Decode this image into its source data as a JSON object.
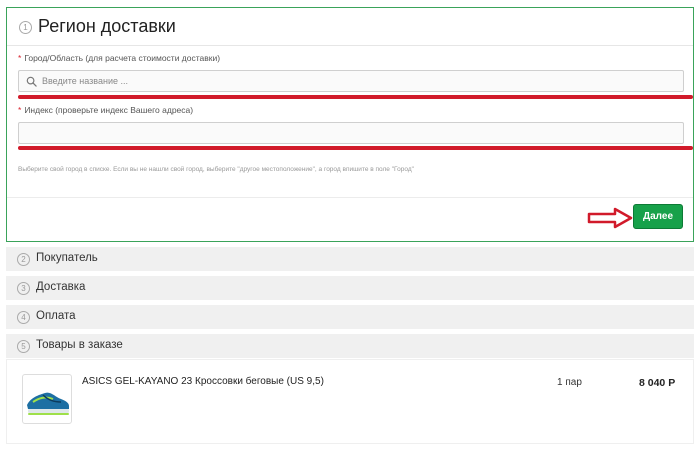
{
  "region": {
    "step": "1",
    "title": "Регион доставки",
    "city_label": "Город/Область (для расчета стоимости доставки)",
    "city_placeholder": "Введите название ...",
    "index_label": "Индекс (проверьте индекс Вашего адреса)",
    "index_value": "",
    "required_mark": "*",
    "hint": "Выберите свой город в списке. Если вы не нашли свой город, выберите \"другое местоположение\", а город впишите в поле \"Город\"",
    "next_button": "Далее"
  },
  "sections": [
    {
      "step": "2",
      "label": "Покупатель"
    },
    {
      "step": "3",
      "label": "Доставка"
    },
    {
      "step": "4",
      "label": "Оплата"
    },
    {
      "step": "5",
      "label": "Товары в заказе"
    }
  ],
  "cart": {
    "item": {
      "name": "ASICS GEL-KAYANO 23 Кроссовки беговые (US 9,5)",
      "quantity": "1 пар",
      "price": "8 040 Р"
    }
  },
  "colors": {
    "accent_green": "#17a14a",
    "panel_border": "#3aa35a",
    "highlight_red": "#d11a2a"
  },
  "icons": {
    "search": "search-icon",
    "arrow": "arrow-right-icon"
  }
}
